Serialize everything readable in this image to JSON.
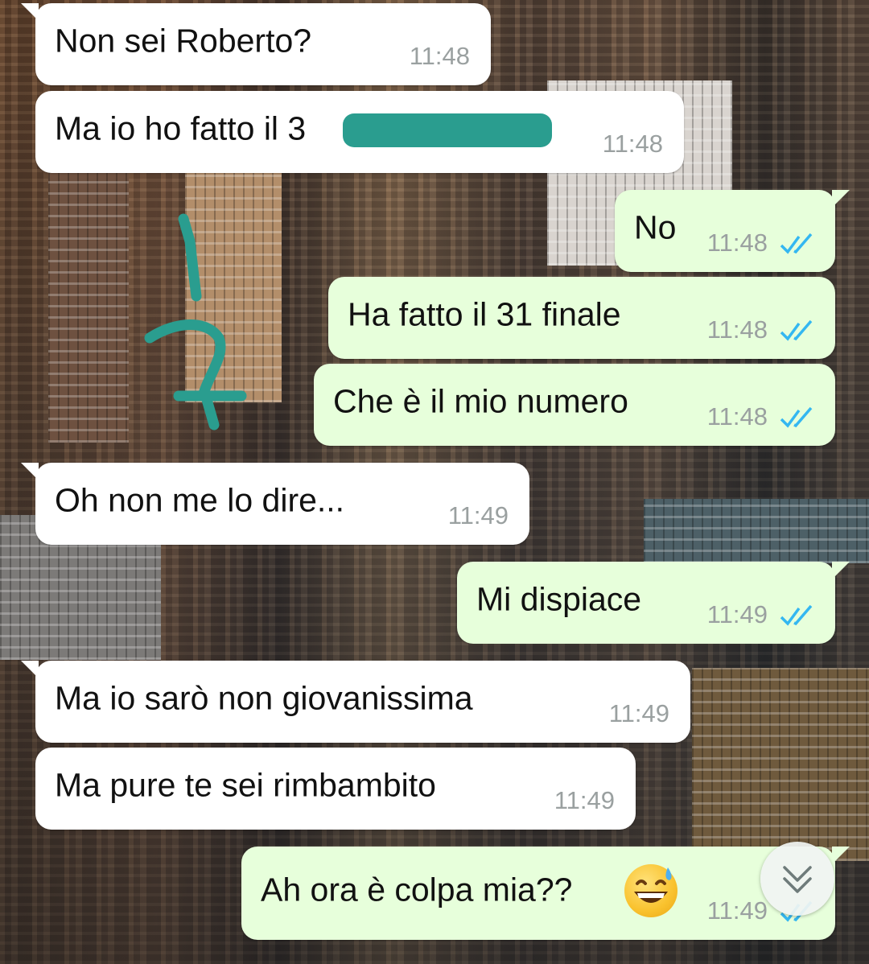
{
  "colors": {
    "incoming_bubble": "#ffffff",
    "outgoing_bubble": "#e7ffdb",
    "read_ticks": "#34b7f1",
    "timestamp": "#9aa0a0",
    "redaction": "#2a9d8f"
  },
  "messages": [
    {
      "direction": "incoming",
      "text": "Non sei Roberto?",
      "time": "11:48"
    },
    {
      "direction": "incoming",
      "text_before": "Ma io ho fatto il 3",
      "text_after": "21",
      "redacted": true,
      "time": "11:48"
    },
    {
      "direction": "outgoing",
      "text": "No",
      "time": "11:48",
      "status": "read"
    },
    {
      "direction": "outgoing",
      "text": "Ha fatto il 31 finale",
      "time": "11:48",
      "status": "read"
    },
    {
      "direction": "outgoing",
      "text": "Che è il mio numero",
      "time": "11:48",
      "status": "read"
    },
    {
      "direction": "incoming",
      "text": "Oh non me lo dire...",
      "time": "11:49"
    },
    {
      "direction": "outgoing",
      "text": "Mi dispiace",
      "time": "11:49",
      "status": "read"
    },
    {
      "direction": "incoming",
      "text": "Ma io sarò non giovanissima",
      "time": "11:49"
    },
    {
      "direction": "incoming",
      "text": "Ma pure te sei rimbambito",
      "time": "11:49"
    },
    {
      "direction": "outgoing",
      "text": "Ah ora è colpa mia??",
      "emoji": "grinning-face-with-sweat",
      "time": "11:49",
      "status": "read"
    }
  ],
  "scroll_button": {
    "icon": "double-chevron-down-icon"
  }
}
